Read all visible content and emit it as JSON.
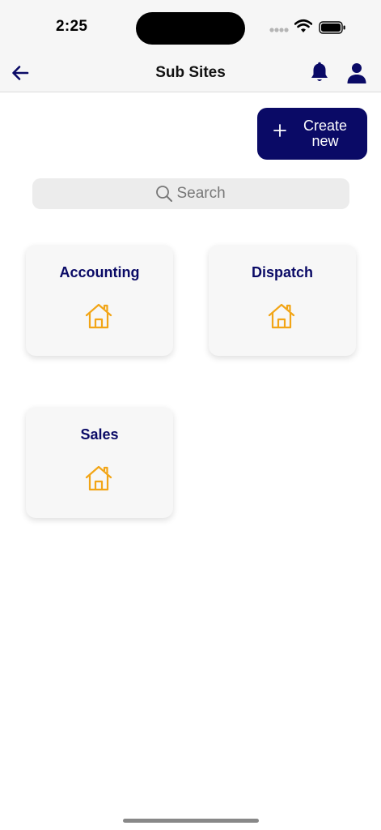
{
  "status_bar": {
    "time": "2:25"
  },
  "nav": {
    "title": "Sub Sites",
    "back_icon": "arrow-left-icon",
    "notification_icon": "bell-icon",
    "profile_icon": "user-icon"
  },
  "create_button": {
    "label": "Create\nnew",
    "icon": "plus-icon"
  },
  "search": {
    "placeholder": "Search",
    "icon": "search-icon"
  },
  "sites": [
    {
      "name": "Accounting",
      "icon": "home-icon"
    },
    {
      "name": "Dispatch",
      "icon": "home-icon"
    },
    {
      "name": "Sales",
      "icon": "home-icon"
    }
  ],
  "colors": {
    "primary": "#0a0a66",
    "icon_accent": "#f2a516",
    "card_background": "#f7f7f7"
  }
}
